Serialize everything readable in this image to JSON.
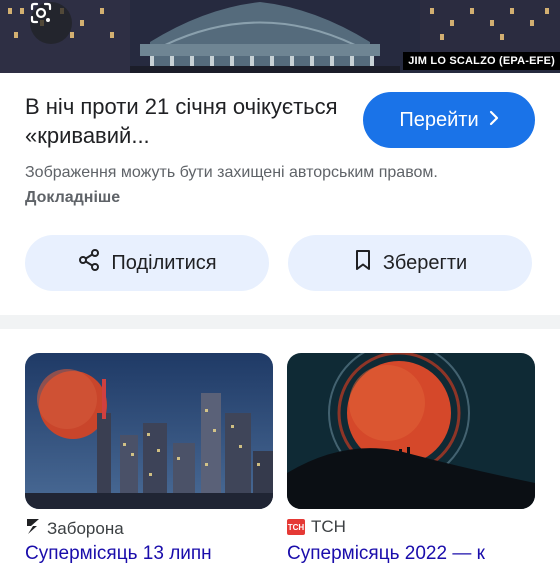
{
  "hero": {
    "credit": "JIM LO SCALZO (EPA-EFE)",
    "lens_icon": "google-lens-icon"
  },
  "result": {
    "title": "В ніч проти 21 січня очікується «кривавий...",
    "go_label": "Перейти",
    "go_icon": "chevron-right-icon",
    "copyright_text": "Зображення можуть бути захищені авторським правом.",
    "more_label": "Докладніше"
  },
  "actions": {
    "share_label": "Поділитися",
    "share_icon": "share-icon",
    "save_label": "Зберегти",
    "save_icon": "bookmark-icon"
  },
  "related": [
    {
      "source": "Заборона",
      "source_icon": "zaborona-logo-icon",
      "caption": "Супермісяць 13 липн"
    },
    {
      "source": "TCH",
      "source_icon": "tsn-logo-icon",
      "logo_text": "ТСН",
      "caption": "Супермісяць 2022 — к"
    }
  ],
  "colors": {
    "accent": "#1a73e8",
    "pill_bg": "#e8f0fe",
    "moon": "#c9452b"
  }
}
